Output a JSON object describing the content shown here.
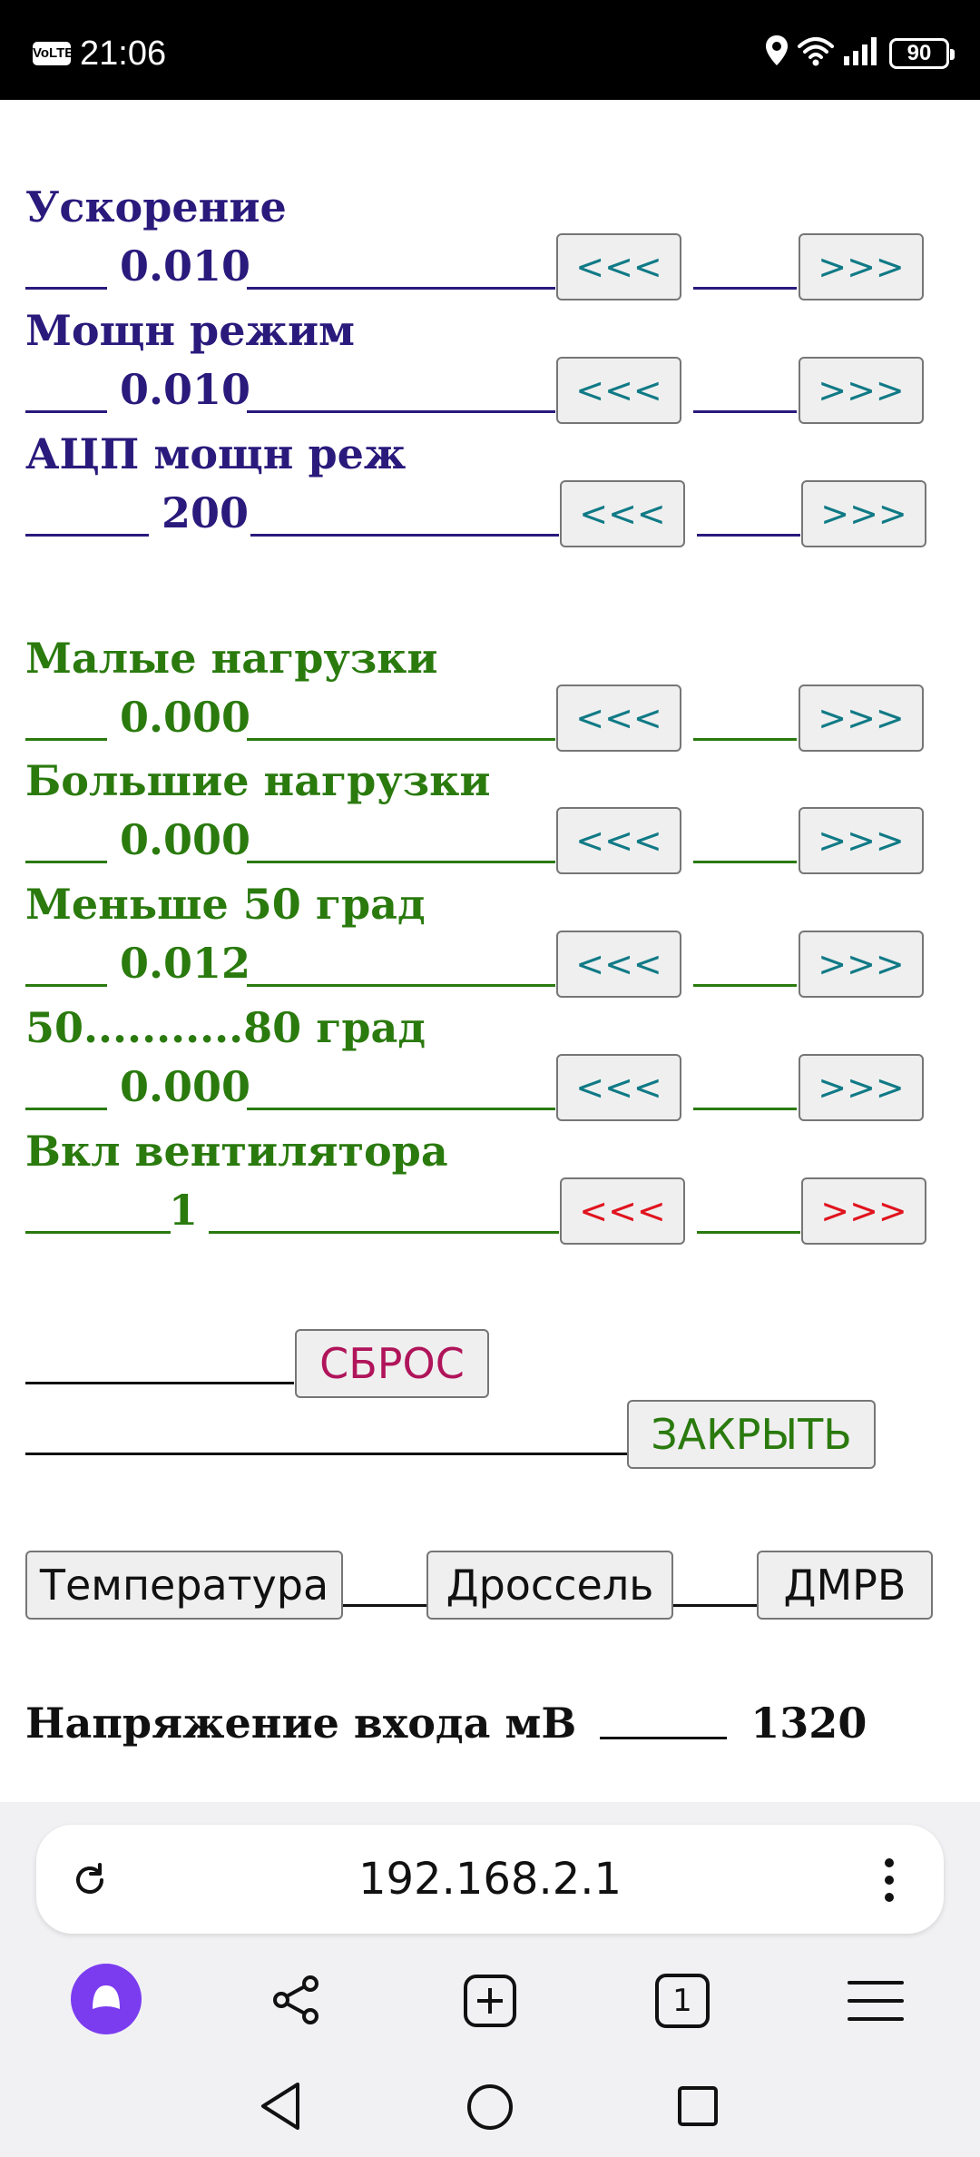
{
  "status_bar": {
    "volte": "VoLTE",
    "time": "21:06",
    "battery": "90"
  },
  "groups": [
    {
      "color": "blue",
      "items": [
        {
          "label": "Ускорение",
          "value": "0.010",
          "dec": "<<<",
          "inc": ">>>"
        },
        {
          "label": "Мощн режим",
          "value": "0.010",
          "dec": "<<<",
          "inc": ">>>"
        },
        {
          "label": "АЦП мощн реж",
          "value": "200",
          "dec": "<<<",
          "inc": ">>>"
        }
      ]
    },
    {
      "color": "green",
      "items": [
        {
          "label": "Малые нагрузки",
          "value": "0.000",
          "dec": "<<<",
          "inc": ">>>"
        },
        {
          "label": "Большие нагрузки",
          "value": "0.000",
          "dec": "<<<",
          "inc": ">>>"
        },
        {
          "label": "Меньше 50 град",
          "value": "0.012",
          "dec": "<<<",
          "inc": ">>>"
        },
        {
          "label": "50...........80 град",
          "value": "0.000",
          "dec": "<<<",
          "inc": ">>>"
        },
        {
          "label": "Вкл вентилятора",
          "value": "1",
          "dec": "<<<",
          "inc": ">>>"
        }
      ]
    }
  ],
  "actions": {
    "reset": "СБРОС",
    "close": "ЗАКРЫТЬ"
  },
  "nav_buttons": {
    "temperature": "Температура",
    "throttle": "Дроссель",
    "dmrv": "ДМРВ"
  },
  "voltage": {
    "label": "Напряжение входа мВ",
    "value": "1320"
  },
  "browser": {
    "url": "192.168.2.1",
    "tab_count": "1"
  },
  "colors": {
    "blue": "#2a1a7c",
    "green": "#2a7a0e",
    "arrow_teal": "#107a86",
    "arrow_red": "#e0141e",
    "reset_text": "#b0145a",
    "close_text": "#2a7a0e",
    "assistant": "#7b3cf0"
  }
}
